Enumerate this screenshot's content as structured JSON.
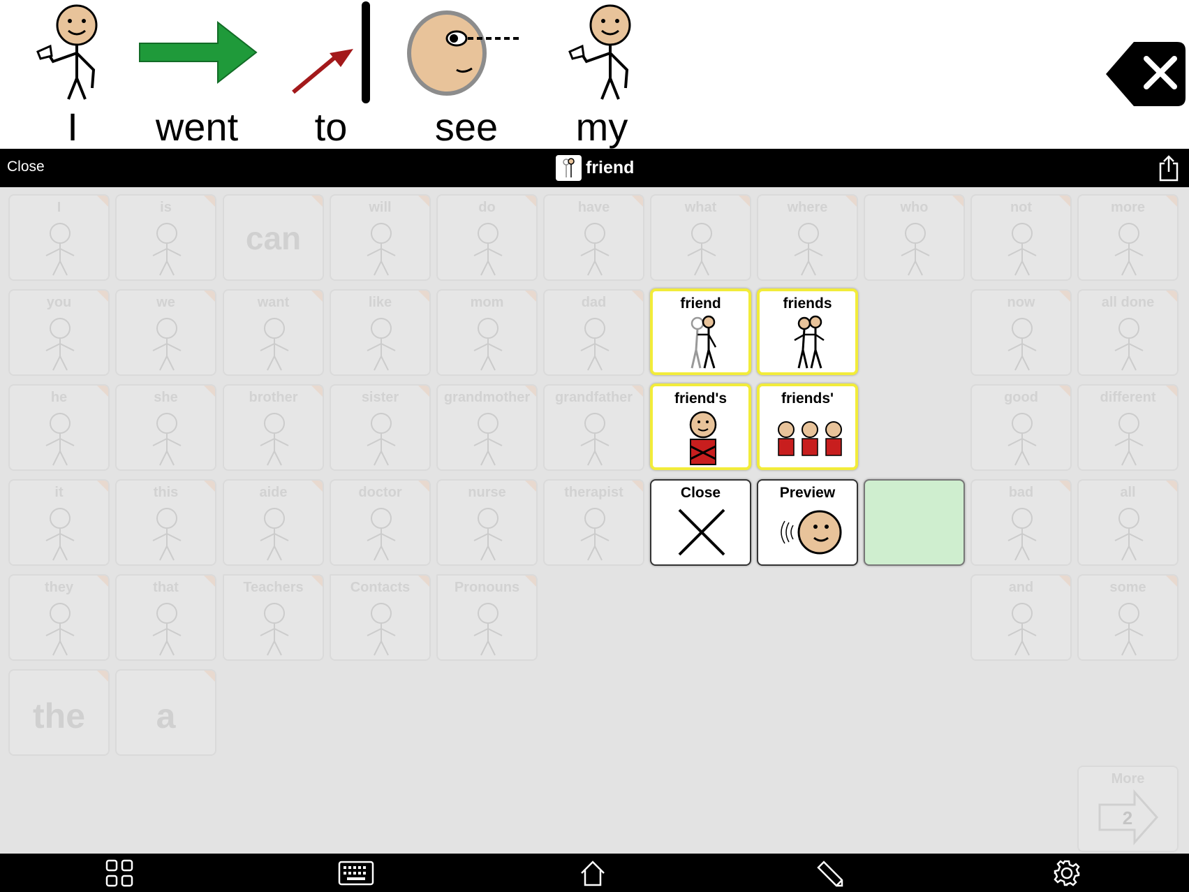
{
  "sentence": {
    "words": [
      "I",
      "went",
      "to",
      "see",
      "my"
    ]
  },
  "header": {
    "close_label": "Close",
    "title": "friend"
  },
  "grid": {
    "rows": [
      [
        "I",
        "is",
        "can",
        "will",
        "do",
        "have",
        "what",
        "where",
        "who",
        "",
        "not",
        "more"
      ],
      [
        "you",
        "we",
        "want",
        "like",
        "mom",
        "dad",
        "",
        "",
        "",
        "",
        "now",
        "all done"
      ],
      [
        "he",
        "she",
        "brother",
        "sister",
        "grandmother",
        "grandfather",
        "",
        "",
        "",
        "",
        "good",
        "different"
      ],
      [
        "it",
        "this",
        "aide",
        "doctor",
        "nurse",
        "therapist",
        "",
        "",
        "",
        "",
        "bad",
        "all"
      ],
      [
        "they",
        "that",
        "Teachers",
        "Contacts",
        "Pronouns",
        "",
        "",
        "",
        "",
        "",
        "and",
        "some"
      ],
      [
        "the",
        "a",
        "",
        "",
        "",
        "",
        "",
        "",
        "",
        "",
        "",
        ""
      ]
    ],
    "more_label": "More",
    "more_page": "2"
  },
  "popover": {
    "items": [
      "friend",
      "friends",
      "friend's",
      "friends'"
    ],
    "close_label": "Close",
    "preview_label": "Preview"
  },
  "toolbar": {
    "icons": [
      "grid-icon",
      "keyboard-icon",
      "home-icon",
      "pencil-icon",
      "gear-icon"
    ]
  },
  "colors": {
    "popover_border": "#f2ec3a",
    "empty_cell": "#cfeecf",
    "arrow_green": "#1f9a3a",
    "arrow_red": "#a3191b",
    "skin": "#e8c39a"
  }
}
